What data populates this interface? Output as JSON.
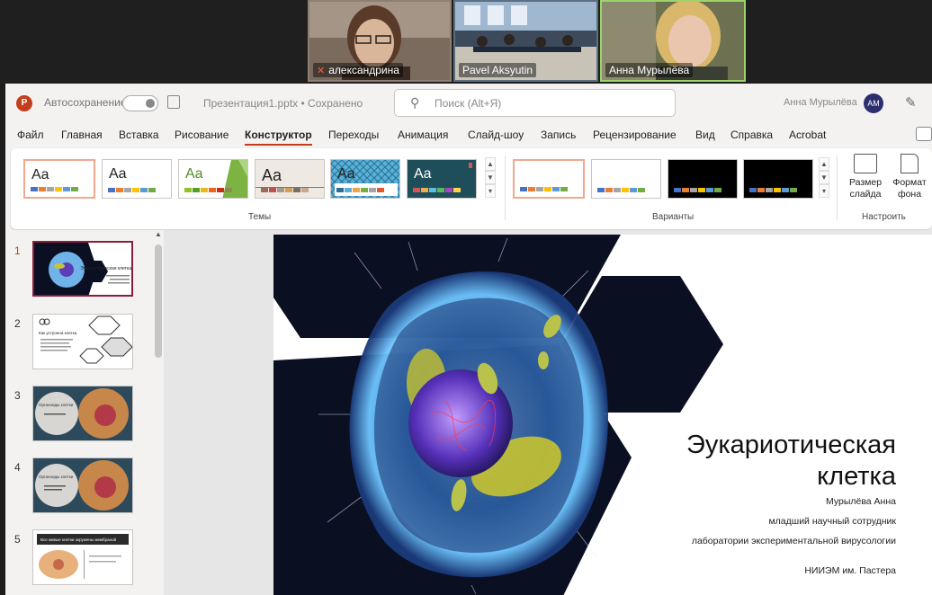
{
  "video": {
    "participants": [
      {
        "name": "александрина",
        "muted": true
      },
      {
        "name": "Pavel Aksyutin",
        "muted": false
      },
      {
        "name": "Анна Мурылёва",
        "muted": false
      }
    ]
  },
  "titlebar": {
    "autosave_label": "Автосохранение",
    "toggle_state": "Выкл",
    "filename": "Презентация1.pptx • Сохранено",
    "search_placeholder": "Поиск (Alt+Я)",
    "user_name": "Анна Мурылёва",
    "user_initials": "АМ"
  },
  "tabs": [
    {
      "label": "Файл"
    },
    {
      "label": "Главная"
    },
    {
      "label": "Вставка"
    },
    {
      "label": "Рисование"
    },
    {
      "label": "Конструктор",
      "active": true
    },
    {
      "label": "Переходы"
    },
    {
      "label": "Анимация"
    },
    {
      "label": "Слайд-шоу"
    },
    {
      "label": "Запись"
    },
    {
      "label": "Рецензирование"
    },
    {
      "label": "Вид"
    },
    {
      "label": "Справка"
    },
    {
      "label": "Acrobat"
    }
  ],
  "ribbon": {
    "themes_label": "Темы",
    "variants_label": "Варианты",
    "customize_label": "Настроить",
    "theme_sample": "Aa",
    "slide_size_label": "Размер слайда",
    "background_format_label": "Формат фона",
    "swatch_colors": [
      "#4472c4",
      "#ed7d31",
      "#a5a5a5",
      "#ffc000",
      "#5b9bd5",
      "#70ad47"
    ]
  },
  "slides_panel": {
    "slides": [
      {
        "number": "1",
        "active": true,
        "title": "Эукариотическая клетка"
      },
      {
        "number": "2",
        "title": "Как устроена клетка"
      },
      {
        "number": "3",
        "title": "Органоиды клетки"
      },
      {
        "number": "4",
        "title": "Органоиды клетки"
      },
      {
        "number": "5",
        "title": "Все живые клетки окружены мембраной"
      }
    ]
  },
  "slide": {
    "title": "Эукариотическая клетка",
    "author": "Мурылёва Анна",
    "position": "младший научный сотрудник",
    "lab": "лаборатории экспериментальной вирусологии",
    "institute": "НИИЭМ им. Пастера"
  },
  "colors": {
    "accent": "#c43e1c",
    "slide_dark": "#0b0f22",
    "active_thumb_border": "#8b1d3a"
  }
}
